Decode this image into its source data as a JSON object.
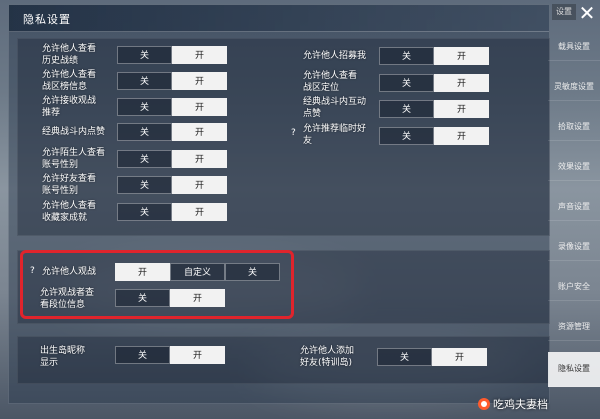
{
  "title": "隐私设置",
  "close_glyph": "✕",
  "top_chip": "设置",
  "on": "开",
  "off": "关",
  "custom": "自定义",
  "help": "?",
  "left_settings": [
    {
      "label": "允许他人查看\n历史战绩",
      "value": "on"
    },
    {
      "label": "允许他人查看\n战区榜信息",
      "value": "on"
    },
    {
      "label": "允许接收观战\n推荐",
      "value": "on"
    },
    {
      "label": "经典战斗内点赞",
      "value": "on"
    },
    {
      "label": "允许陌生人查看\n账号性别",
      "value": "on"
    },
    {
      "label": "允许好友查看\n账号性别",
      "value": "on"
    },
    {
      "label": "允许他人查看\n收藏家成就",
      "value": "on"
    }
  ],
  "right_settings": [
    {
      "label": "允许他人招募我",
      "value": "on",
      "help": false
    },
    {
      "label": "允许他人查看\n战区定位",
      "value": "on",
      "help": false
    },
    {
      "label": "经典战斗内互动\n点赞",
      "value": "on",
      "help": false
    },
    {
      "label": "允许推荐临时好\n友",
      "value": "on",
      "help": true
    }
  ],
  "spectate": {
    "label": "允许他人观战",
    "selected": "开"
  },
  "spectator_rank": {
    "label": "允许观战者查\n看段位信息",
    "value": "on"
  },
  "island_name": {
    "label": "出生岛昵称\n显示",
    "value": "on"
  },
  "add_friend": {
    "label": "允许他人添加\n好友(特训岛)",
    "value": "on"
  },
  "sidebar": [
    {
      "label": "载具设置",
      "active": false
    },
    {
      "label": "灵敏度设置",
      "active": false
    },
    {
      "label": "拾取设置",
      "active": false
    },
    {
      "label": "效果设置",
      "active": false
    },
    {
      "label": "声音设置",
      "active": false
    },
    {
      "label": "录像设置",
      "active": false
    },
    {
      "label": "账户安全",
      "active": false
    },
    {
      "label": "资源管理",
      "active": false
    },
    {
      "label": "隐私设置",
      "active": true
    }
  ],
  "watermark": "吃鸡夫妻档",
  "colors": {
    "highlight": "#e0242c",
    "active_seg": "#f2f2f2"
  }
}
